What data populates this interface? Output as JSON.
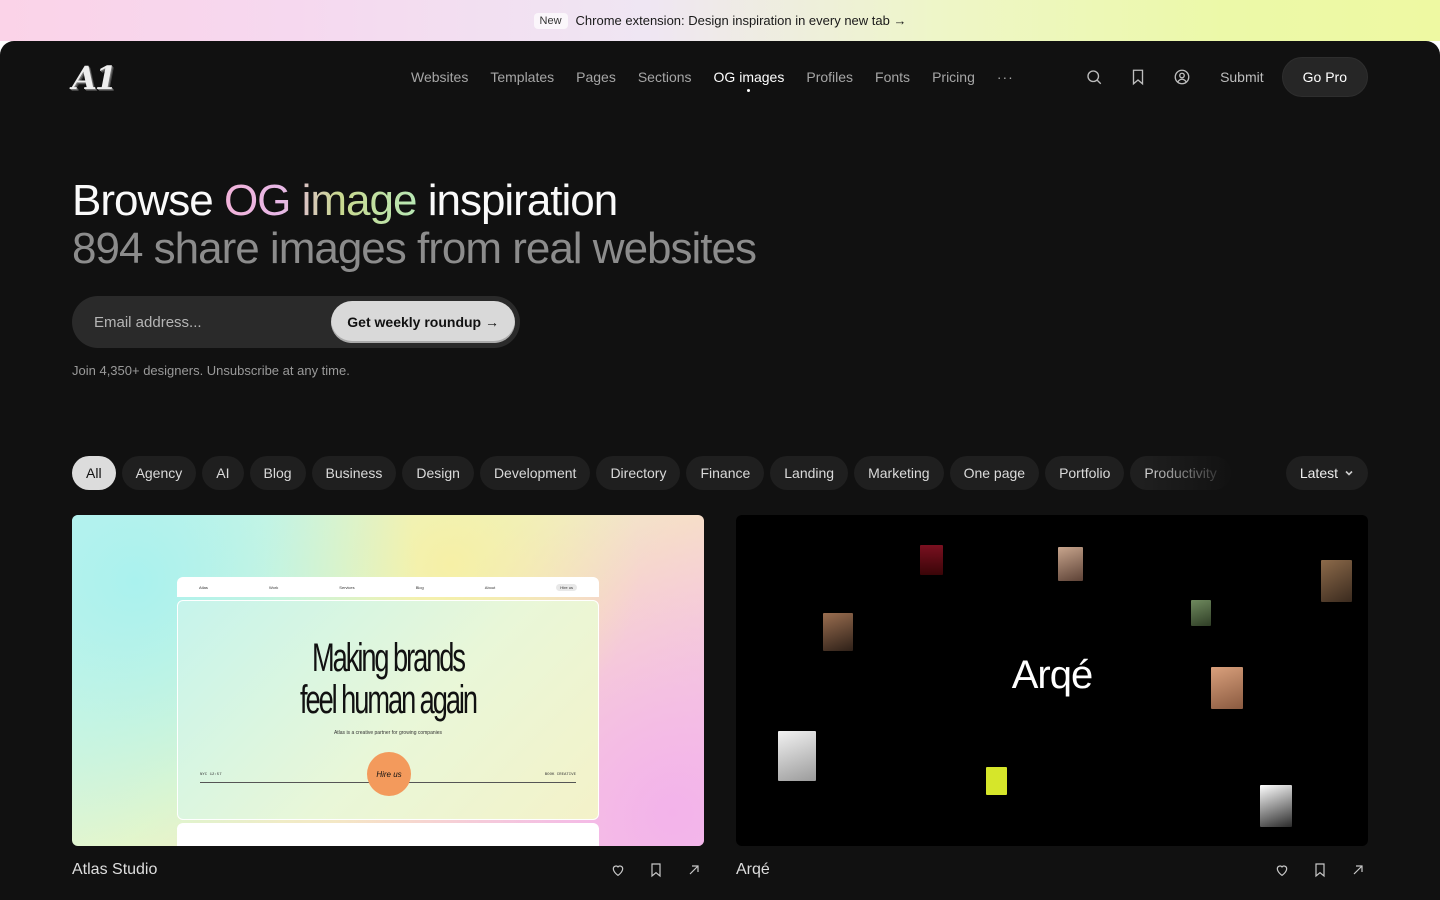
{
  "announcement": {
    "badge": "New",
    "text": "Chrome extension: Design inspiration in every new tab →"
  },
  "header": {
    "logo": "A1",
    "nav": [
      {
        "label": "Websites"
      },
      {
        "label": "Templates"
      },
      {
        "label": "Pages"
      },
      {
        "label": "Sections"
      },
      {
        "label": "OG images",
        "active": true
      },
      {
        "label": "Profiles"
      },
      {
        "label": "Fonts"
      },
      {
        "label": "Pricing"
      }
    ],
    "more": "···",
    "submit": "Submit",
    "go_pro": "Go Pro",
    "icons": [
      "search-icon",
      "bookmark-icon",
      "user-icon"
    ]
  },
  "hero": {
    "title_pre": "Browse ",
    "title_grad": "OG image",
    "title_post": " inspiration",
    "subtitle": "894 share images from real websites"
  },
  "subscribe": {
    "placeholder": "Email address...",
    "button": "Get weekly roundup →",
    "note": "Join 4,350+ designers. Unsubscribe at any time."
  },
  "filters": {
    "chips": [
      "All",
      "Agency",
      "AI",
      "Blog",
      "Business",
      "Design",
      "Development",
      "Directory",
      "Finance",
      "Landing",
      "Marketing",
      "One page",
      "Portfolio",
      "Productivity"
    ],
    "active": "All",
    "sort": "Latest"
  },
  "cards": [
    {
      "title": "Atlas Studio",
      "thumb": {
        "nav": [
          "Atlas",
          "Work",
          "Services",
          "Blog",
          "About",
          "Hire us"
        ],
        "headline_1": "Making brands",
        "headline_2": "feel human again",
        "tagline": "Atlas is a creative partner for growing companies",
        "left_meta": "NYC 12:57",
        "right_meta": "BOOK CREATIVE",
        "cta": "Hire us"
      }
    },
    {
      "title": "Arqé",
      "thumb": {
        "wordmark": "Arqé"
      }
    }
  ],
  "colors": {
    "background": "#111111",
    "chip": "#1f1f1f",
    "chip_active": "#dcdcdc",
    "accent_peach": "#f39a5c"
  }
}
